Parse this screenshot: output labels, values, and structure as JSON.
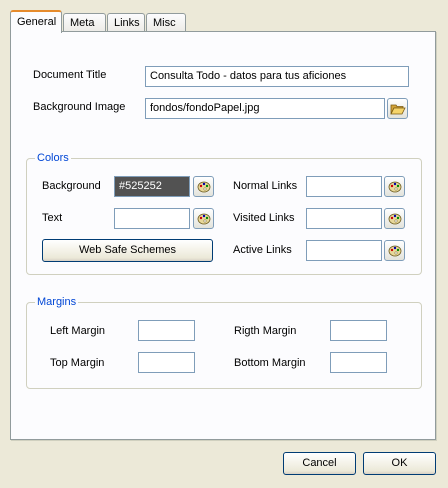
{
  "tabs": [
    {
      "label": "General"
    },
    {
      "label": "Meta"
    },
    {
      "label": "Links"
    },
    {
      "label": "Misc"
    }
  ],
  "general": {
    "document_title_label": "Document Title",
    "document_title_value": "Consulta Todo - datos para tus aficiones",
    "background_image_label": "Background Image",
    "background_image_value": "fondos/fondoPapel.jpg",
    "browse_icon": "folder-open-icon"
  },
  "colors": {
    "legend": "Colors",
    "background_label": "Background",
    "background_value": "#525252",
    "text_label": "Text",
    "text_value": "",
    "normal_links_label": "Normal Links",
    "normal_links_value": "",
    "visited_links_label": "Visited Links",
    "visited_links_value": "",
    "active_links_label": "Active Links",
    "active_links_value": "",
    "web_safe_button": "Web Safe Schemes",
    "picker_icon": "color-palette-icon"
  },
  "margins": {
    "legend": "Margins",
    "left_label": "Left Margin",
    "left_value": "",
    "right_label": "Rigth Margin",
    "right_value": "",
    "top_label": "Top Margin",
    "top_value": "",
    "bottom_label": "Bottom Margin",
    "bottom_value": ""
  },
  "footer": {
    "cancel_label": "Cancel",
    "ok_label": "OK"
  },
  "theme": {
    "accent": "#e68b2c",
    "group_title": "#0046d5",
    "field_border": "#7f9db9",
    "dialog_bg": "#ece9d8"
  }
}
